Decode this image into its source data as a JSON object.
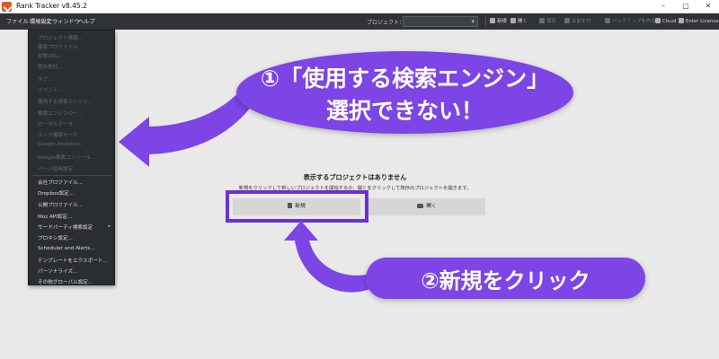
{
  "window": {
    "title": "Rank Tracker v8.45.2",
    "minimize": "–",
    "maximize": "▢",
    "close": "✕"
  },
  "menubar": {
    "items": [
      "ファイル",
      "環境設定",
      "ウィンドウ",
      "ヘルプ"
    ]
  },
  "toolbar": {
    "project_label": "プロジェクト：",
    "project_value": "",
    "new_label": "新規",
    "open_label": "開く",
    "save_label": "保存",
    "save_as_label": "名前を付",
    "backup_label": "バックアップを作る",
    "cloud_label": "Cloud",
    "license_label": "Enter License"
  },
  "dropdown": {
    "disabled_items": [
      "プロジェクト情報...",
      "顧客プロファイル...",
      "対象URL...",
      "競合他社...",
      "タグ...",
      "イベント...",
      "使用する検索エンジン...",
      "検索エンジンの一...",
      "ローカルデータ...",
      "ランク確認モード...",
      "Google Analytics...",
      "Google検索コンソール...",
      "ページ使用設定..."
    ],
    "enabled_items": [
      "会社プロファイル...",
      "Dropbox設定...",
      "公開プロファイル...",
      "Moz API設定...",
      "サードパーティ検索設定",
      "プロキシ設定...",
      "Scheduler and Alerts...",
      "テンプレートをエクスポート...",
      "パーソナライズ...",
      "その他グローバル設定..."
    ]
  },
  "empty_state": {
    "title": "表示するプロジェクトはありません",
    "subtitle": "新規をクリックして新しいプロジェクトを開始するか、開くをクリックして既存のプロジェクトを開きます。",
    "new_button": "新規",
    "open_button": "開く"
  },
  "annotations": {
    "callout1_line1": "①「使用する検索エンジン」",
    "callout1_line2": "選択できない！",
    "callout2": "②新規をクリック",
    "accent_color": "#7d44e6",
    "highlight_color": "#6a31d8"
  }
}
